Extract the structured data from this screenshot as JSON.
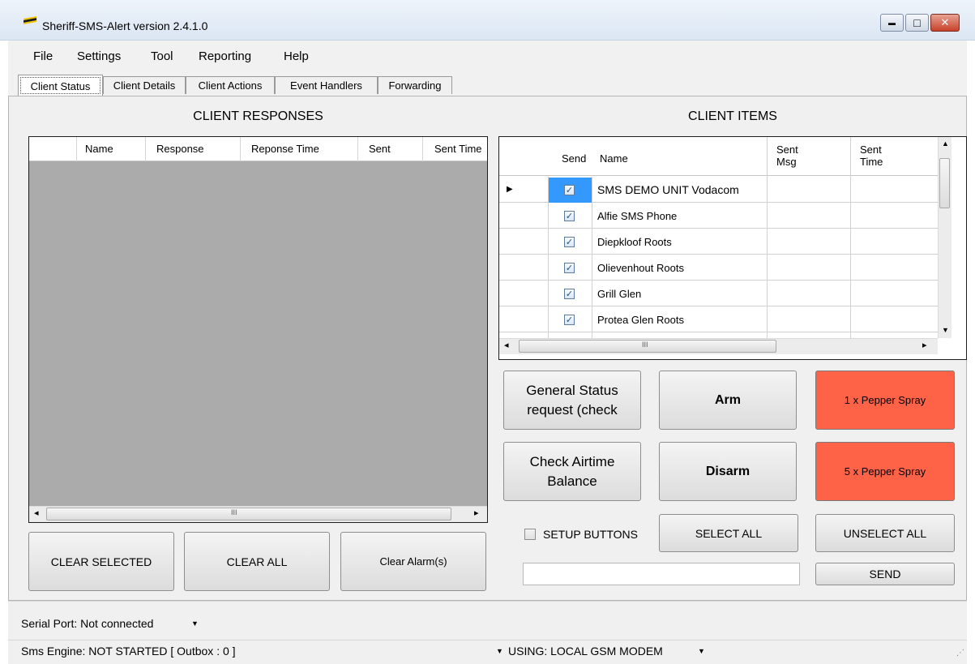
{
  "window": {
    "title": "Sheriff-SMS-Alert version 2.4.1.0",
    "minimize_glyph": "▬",
    "maximize_glyph": "□",
    "close_glyph": "✕"
  },
  "menu": [
    "File",
    "Settings",
    "Tool",
    "Reporting",
    "Help"
  ],
  "tabs": [
    "Client Status",
    "Client Details",
    "Client Actions",
    "Event Handlers",
    "Forwarding"
  ],
  "left_panel": {
    "title": "CLIENT RESPONSES",
    "columns": [
      "Name",
      "Response",
      "Reponse Time",
      "Sent",
      "Sent Time"
    ],
    "scroll_glyph": "III"
  },
  "right_panel": {
    "title": "CLIENT ITEMS",
    "columns": {
      "send": "Send",
      "name": "Name",
      "sent_msg": "Sent\nMsg",
      "sent_time": "Sent\nTime"
    },
    "rows": [
      {
        "name": "SMS DEMO UNIT Vodacom",
        "checked": true,
        "selected": true
      },
      {
        "name": "Alfie SMS Phone",
        "checked": true
      },
      {
        "name": "Diepkloof Roots",
        "checked": true
      },
      {
        "name": "Olievenhout Roots",
        "checked": true
      },
      {
        "name": "Grill Glen",
        "checked": true
      },
      {
        "name": "Protea Glen Roots",
        "checked": true
      }
    ],
    "scroll_glyph": "III"
  },
  "actions": {
    "general_status": "General Status request  (check",
    "arm": "Arm",
    "pepper1": "1 x Pepper Spray",
    "check_airtime": "Check Airtime Balance",
    "disarm": "Disarm",
    "pepper5": "5 x Pepper Spray",
    "setup_buttons": "SETUP BUTTONS",
    "select_all": "SELECT ALL",
    "unselect_all": "UNSELECT ALL",
    "send": "SEND",
    "message_value": ""
  },
  "bottom_buttons": {
    "clear_selected": "CLEAR SELECTED",
    "clear_all": "CLEAR ALL",
    "clear_alarms": "Clear Alarm(s)"
  },
  "status": {
    "serial_port": "Serial Port: Not connected",
    "sms_engine": "Sms Engine: NOT STARTED [ Outbox : 0 ]",
    "using": "USING: LOCAL GSM MODEM"
  },
  "colors": {
    "pepper_button": "#ff6347",
    "grid_background": "#ababab",
    "selected_cell": "#3399ff"
  }
}
